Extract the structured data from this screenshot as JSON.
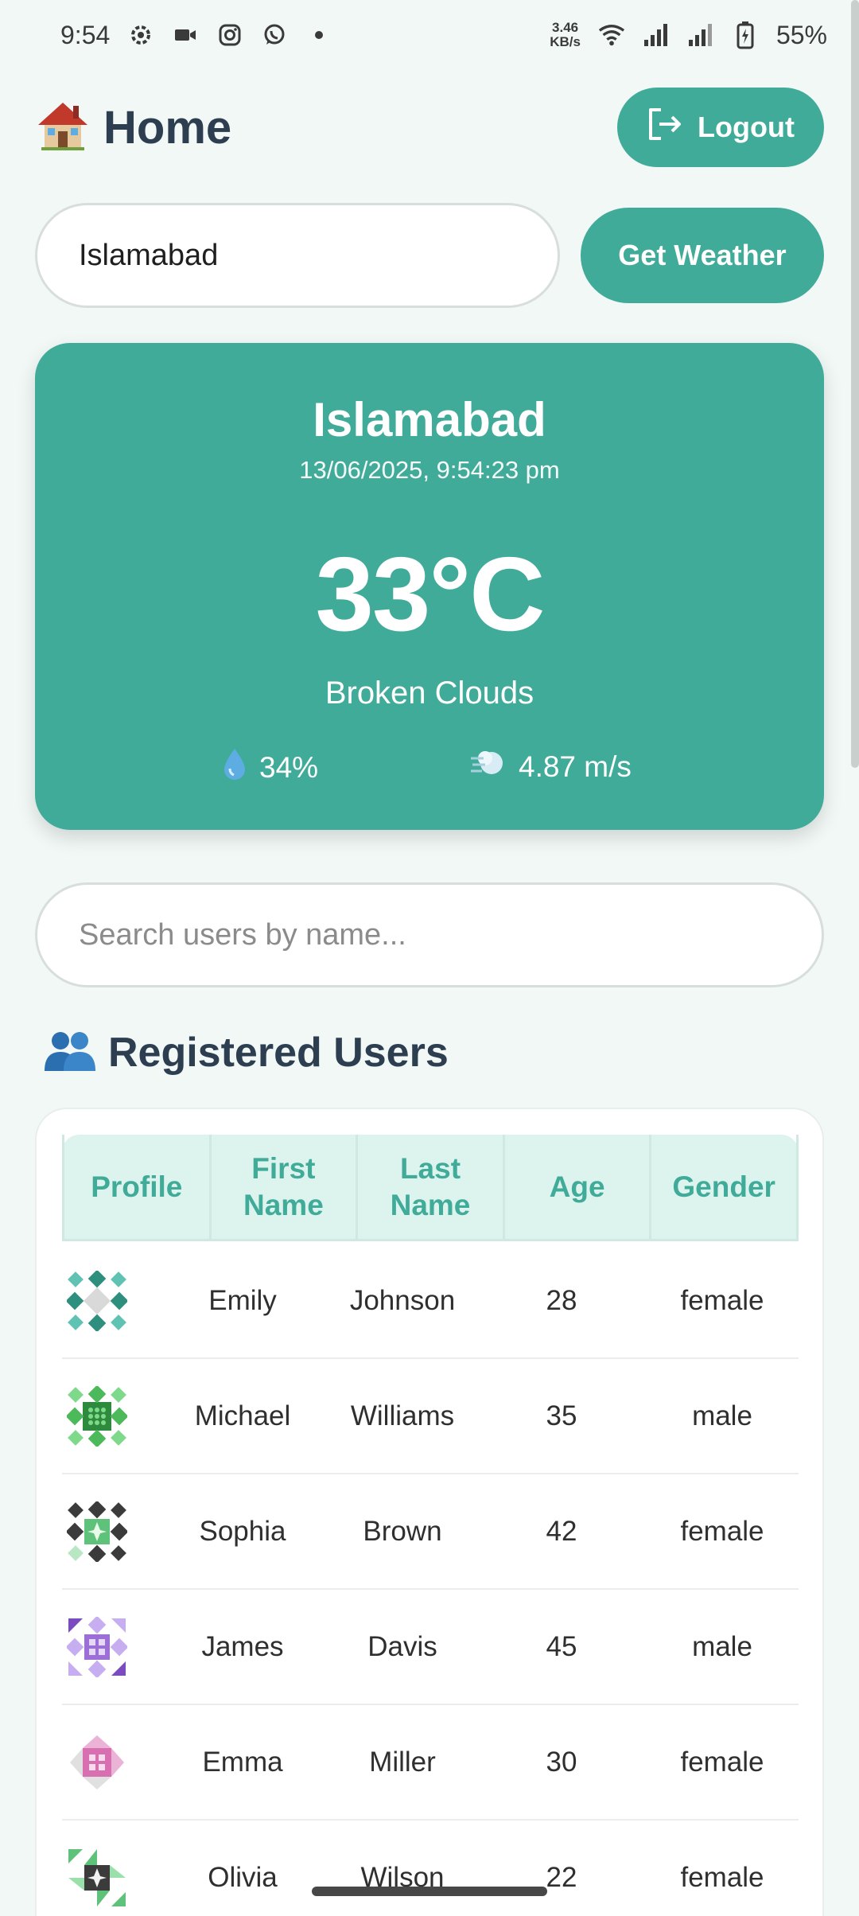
{
  "status_bar": {
    "time": "9:54",
    "speed_value": "3.46",
    "speed_unit": "KB/s",
    "battery": "55%",
    "icons": [
      "settings-icon",
      "video-icon",
      "instagram-icon",
      "whatsapp-icon",
      "dot-icon",
      "wifi-icon",
      "signal-icon",
      "battery-charging-icon"
    ]
  },
  "header": {
    "title": "Home",
    "title_icon": "house-icon",
    "logout_label": "Logout",
    "logout_icon": "logout-icon"
  },
  "city_search": {
    "value": "Islamabad",
    "button_label": "Get Weather"
  },
  "weather": {
    "city": "Islamabad",
    "datetime": "13/06/2025, 9:54:23 pm",
    "temperature": "33°C",
    "description": "Broken Clouds",
    "humidity": "34%",
    "humidity_icon": "droplet-icon",
    "wind": "4.87 m/s",
    "wind_icon": "wind-icon"
  },
  "user_search": {
    "placeholder": "Search users by name..."
  },
  "users_section": {
    "title": "Registered Users",
    "title_icon": "users-icon",
    "columns": [
      "Profile",
      "First Name",
      "Last Name",
      "Age",
      "Gender"
    ],
    "rows": [
      {
        "first": "Emily",
        "last": "Johnson",
        "age": "28",
        "gender": "female"
      },
      {
        "first": "Michael",
        "last": "Williams",
        "age": "35",
        "gender": "male"
      },
      {
        "first": "Sophia",
        "last": "Brown",
        "age": "42",
        "gender": "female"
      },
      {
        "first": "James",
        "last": "Davis",
        "age": "45",
        "gender": "male"
      },
      {
        "first": "Emma",
        "last": "Miller",
        "age": "30",
        "gender": "female"
      },
      {
        "first": "Olivia",
        "last": "Wilson",
        "age": "22",
        "gender": "female"
      }
    ]
  },
  "colors": {
    "accent": "#41ab9a",
    "background": "#f1f8f6",
    "table_header_bg": "#ddf4ee",
    "heading_text": "#2c3e50"
  }
}
